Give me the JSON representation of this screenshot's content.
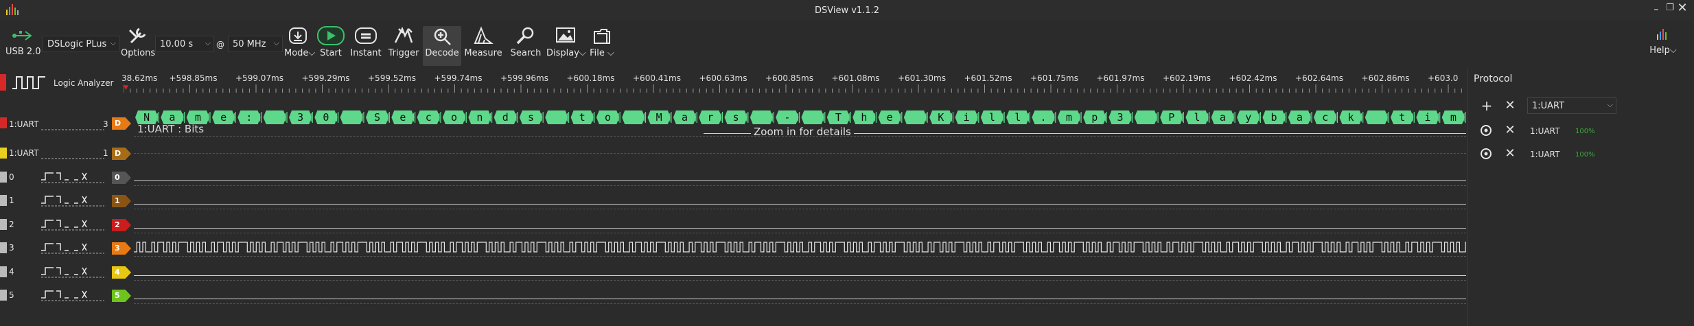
{
  "window": {
    "title": "DSView v1.1.2"
  },
  "toolbar": {
    "device": {
      "usb_label": "USB 2.0",
      "device_name": "DSLogic PLus"
    },
    "options_label": "Options",
    "duration": "10.00 s",
    "at": "@",
    "rate": "50 MHz",
    "buttons": [
      {
        "label": "Mode",
        "icon": "download-icon"
      },
      {
        "label": "Start",
        "icon": "play-icon"
      },
      {
        "label": "Instant",
        "icon": "instant-icon"
      },
      {
        "label": "Trigger",
        "icon": "trigger-icon"
      },
      {
        "label": "Decode",
        "icon": "decode-icon"
      },
      {
        "label": "Measure",
        "icon": "measure-icon"
      },
      {
        "label": "Search",
        "icon": "search-icon"
      },
      {
        "label": "Display",
        "icon": "display-icon"
      },
      {
        "label": "File",
        "icon": "file-icon"
      }
    ],
    "help_label": "Help"
  },
  "ruler": {
    "ticks": [
      "38.62ms",
      "+598.85ms",
      "+599.07ms",
      "+599.29ms",
      "+599.52ms",
      "+599.74ms",
      "+599.96ms",
      "+600.18ms",
      "+600.41ms",
      "+600.63ms",
      "+600.85ms",
      "+601.08ms",
      "+601.30ms",
      "+601.52ms",
      "+601.75ms",
      "+601.97ms",
      "+602.19ms",
      "+602.42ms",
      "+602.64ms",
      "+602.86ms",
      "+603.0"
    ]
  },
  "analyzer": {
    "label": "Logic Analyzer"
  },
  "decoder": {
    "row_label": "1:UART",
    "row_index": "3",
    "badge": "D",
    "sub_label": "1:UART : Bits",
    "zoom_hint": "Zoom in for details",
    "chars": [
      "N",
      "a",
      "m",
      "e",
      ":",
      " ",
      "3",
      "0",
      " ",
      "S",
      "e",
      "c",
      "o",
      "n",
      "d",
      "s",
      " ",
      "t",
      "o",
      " ",
      "M",
      "a",
      "r",
      "s",
      " ",
      "-",
      " ",
      "T",
      "h",
      "e",
      " ",
      "K",
      "i",
      "l",
      "l",
      ".",
      "m",
      "p",
      "3",
      " ",
      "P",
      "l",
      "a",
      "y",
      "b",
      "a",
      "c",
      "k",
      " ",
      "t",
      "i",
      "m"
    ]
  },
  "rows": [
    {
      "name": "1:UART",
      "index": "1",
      "badge": "D",
      "bar_color": "#e8d020",
      "badge_color": "#a76d16"
    },
    {
      "name": "0",
      "index": "",
      "badge": "0",
      "bar_color": "#bbbbbb",
      "badge_color": "#555555"
    },
    {
      "name": "1",
      "index": "",
      "badge": "1",
      "bar_color": "#bbbbbb",
      "badge_color": "#8a5514"
    },
    {
      "name": "2",
      "index": "",
      "badge": "2",
      "bar_color": "#bbbbbb",
      "badge_color": "#cc1c1c"
    },
    {
      "name": "3",
      "index": "",
      "badge": "3",
      "bar_color": "#bbbbbb",
      "badge_color": "#e87a14"
    },
    {
      "name": "4",
      "index": "",
      "badge": "4",
      "bar_color": "#bbbbbb",
      "badge_color": "#e8c614"
    },
    {
      "name": "5",
      "index": "",
      "badge": "5",
      "bar_color": "#bbbbbb",
      "badge_color": "#6cc41c"
    }
  ],
  "protocol": {
    "title": "Protocol",
    "select_value": "1:UART",
    "entries": [
      {
        "name": "1:UART",
        "progress": "100%"
      },
      {
        "name": "1:UART",
        "progress": "100%"
      }
    ]
  },
  "colors": {
    "decode_green": "#5ed88a",
    "accent_red": "#d62828",
    "progress_green": "#3aa83a"
  }
}
